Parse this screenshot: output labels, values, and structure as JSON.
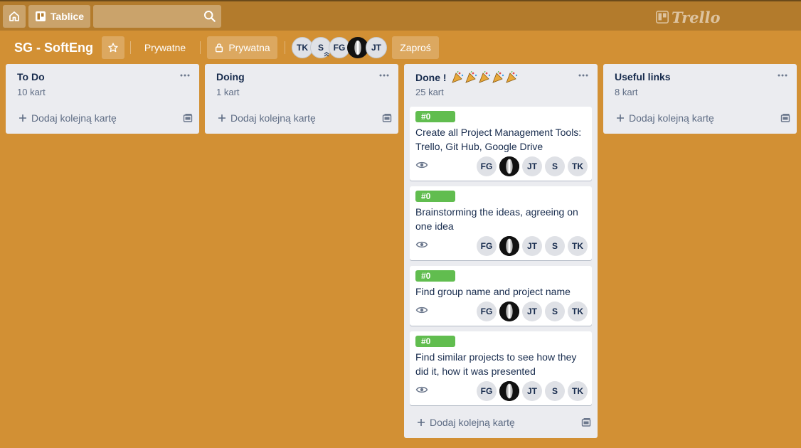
{
  "header": {
    "boards_label": "Tablice",
    "search_placeholder": "",
    "logo_text": "Trello"
  },
  "board": {
    "title": "SG - SoftEng",
    "visibility_team": "Prywatne",
    "visibility": "Prywatna",
    "invite_label": "Zaproś",
    "members": [
      "TK",
      "S",
      "FG",
      "",
      "JT"
    ]
  },
  "lists": [
    {
      "name": "To Do",
      "count": "10 kart",
      "add_label": "Dodaj kolejną kartę"
    },
    {
      "name": "Doing",
      "count": "1 kart",
      "add_label": "Dodaj kolejną kartę"
    },
    {
      "name": "Done !",
      "count": "25 kart",
      "add_label": "Dodaj kolejną kartę",
      "cards": [
        {
          "label": "#0",
          "title": "Create all Project Management Tools: Trello, Git Hub, Google Drive",
          "members": [
            "FG",
            "",
            "JT",
            "S",
            "TK"
          ]
        },
        {
          "label": "#0",
          "title": "Brainstorming the ideas, agreeing on one idea",
          "members": [
            "FG",
            "",
            "JT",
            "S",
            "TK"
          ]
        },
        {
          "label": "#0",
          "title": "Find group name and project name",
          "members": [
            "FG",
            "",
            "JT",
            "S",
            "TK"
          ]
        },
        {
          "label": "#0",
          "title": "Find similar projects to see how they did it, how it was presented",
          "members": [
            "FG",
            "",
            "JT",
            "S",
            "TK"
          ]
        }
      ]
    },
    {
      "name": "Useful links",
      "count": "8 kart",
      "add_label": "Dodaj kolejną kartę"
    }
  ],
  "icons": {
    "home": "home-icon",
    "boards": "board-icon",
    "search": "search-icon",
    "star": "star-icon",
    "lock": "lock-icon",
    "menu": "more-icon",
    "add": "plus-icon",
    "template": "template-icon",
    "watch": "eye-icon",
    "decoration": "party-popper-icon"
  },
  "colors": {
    "background": "#d29034",
    "label_green": "#61bd4f",
    "list_bg": "#ebecf0"
  }
}
